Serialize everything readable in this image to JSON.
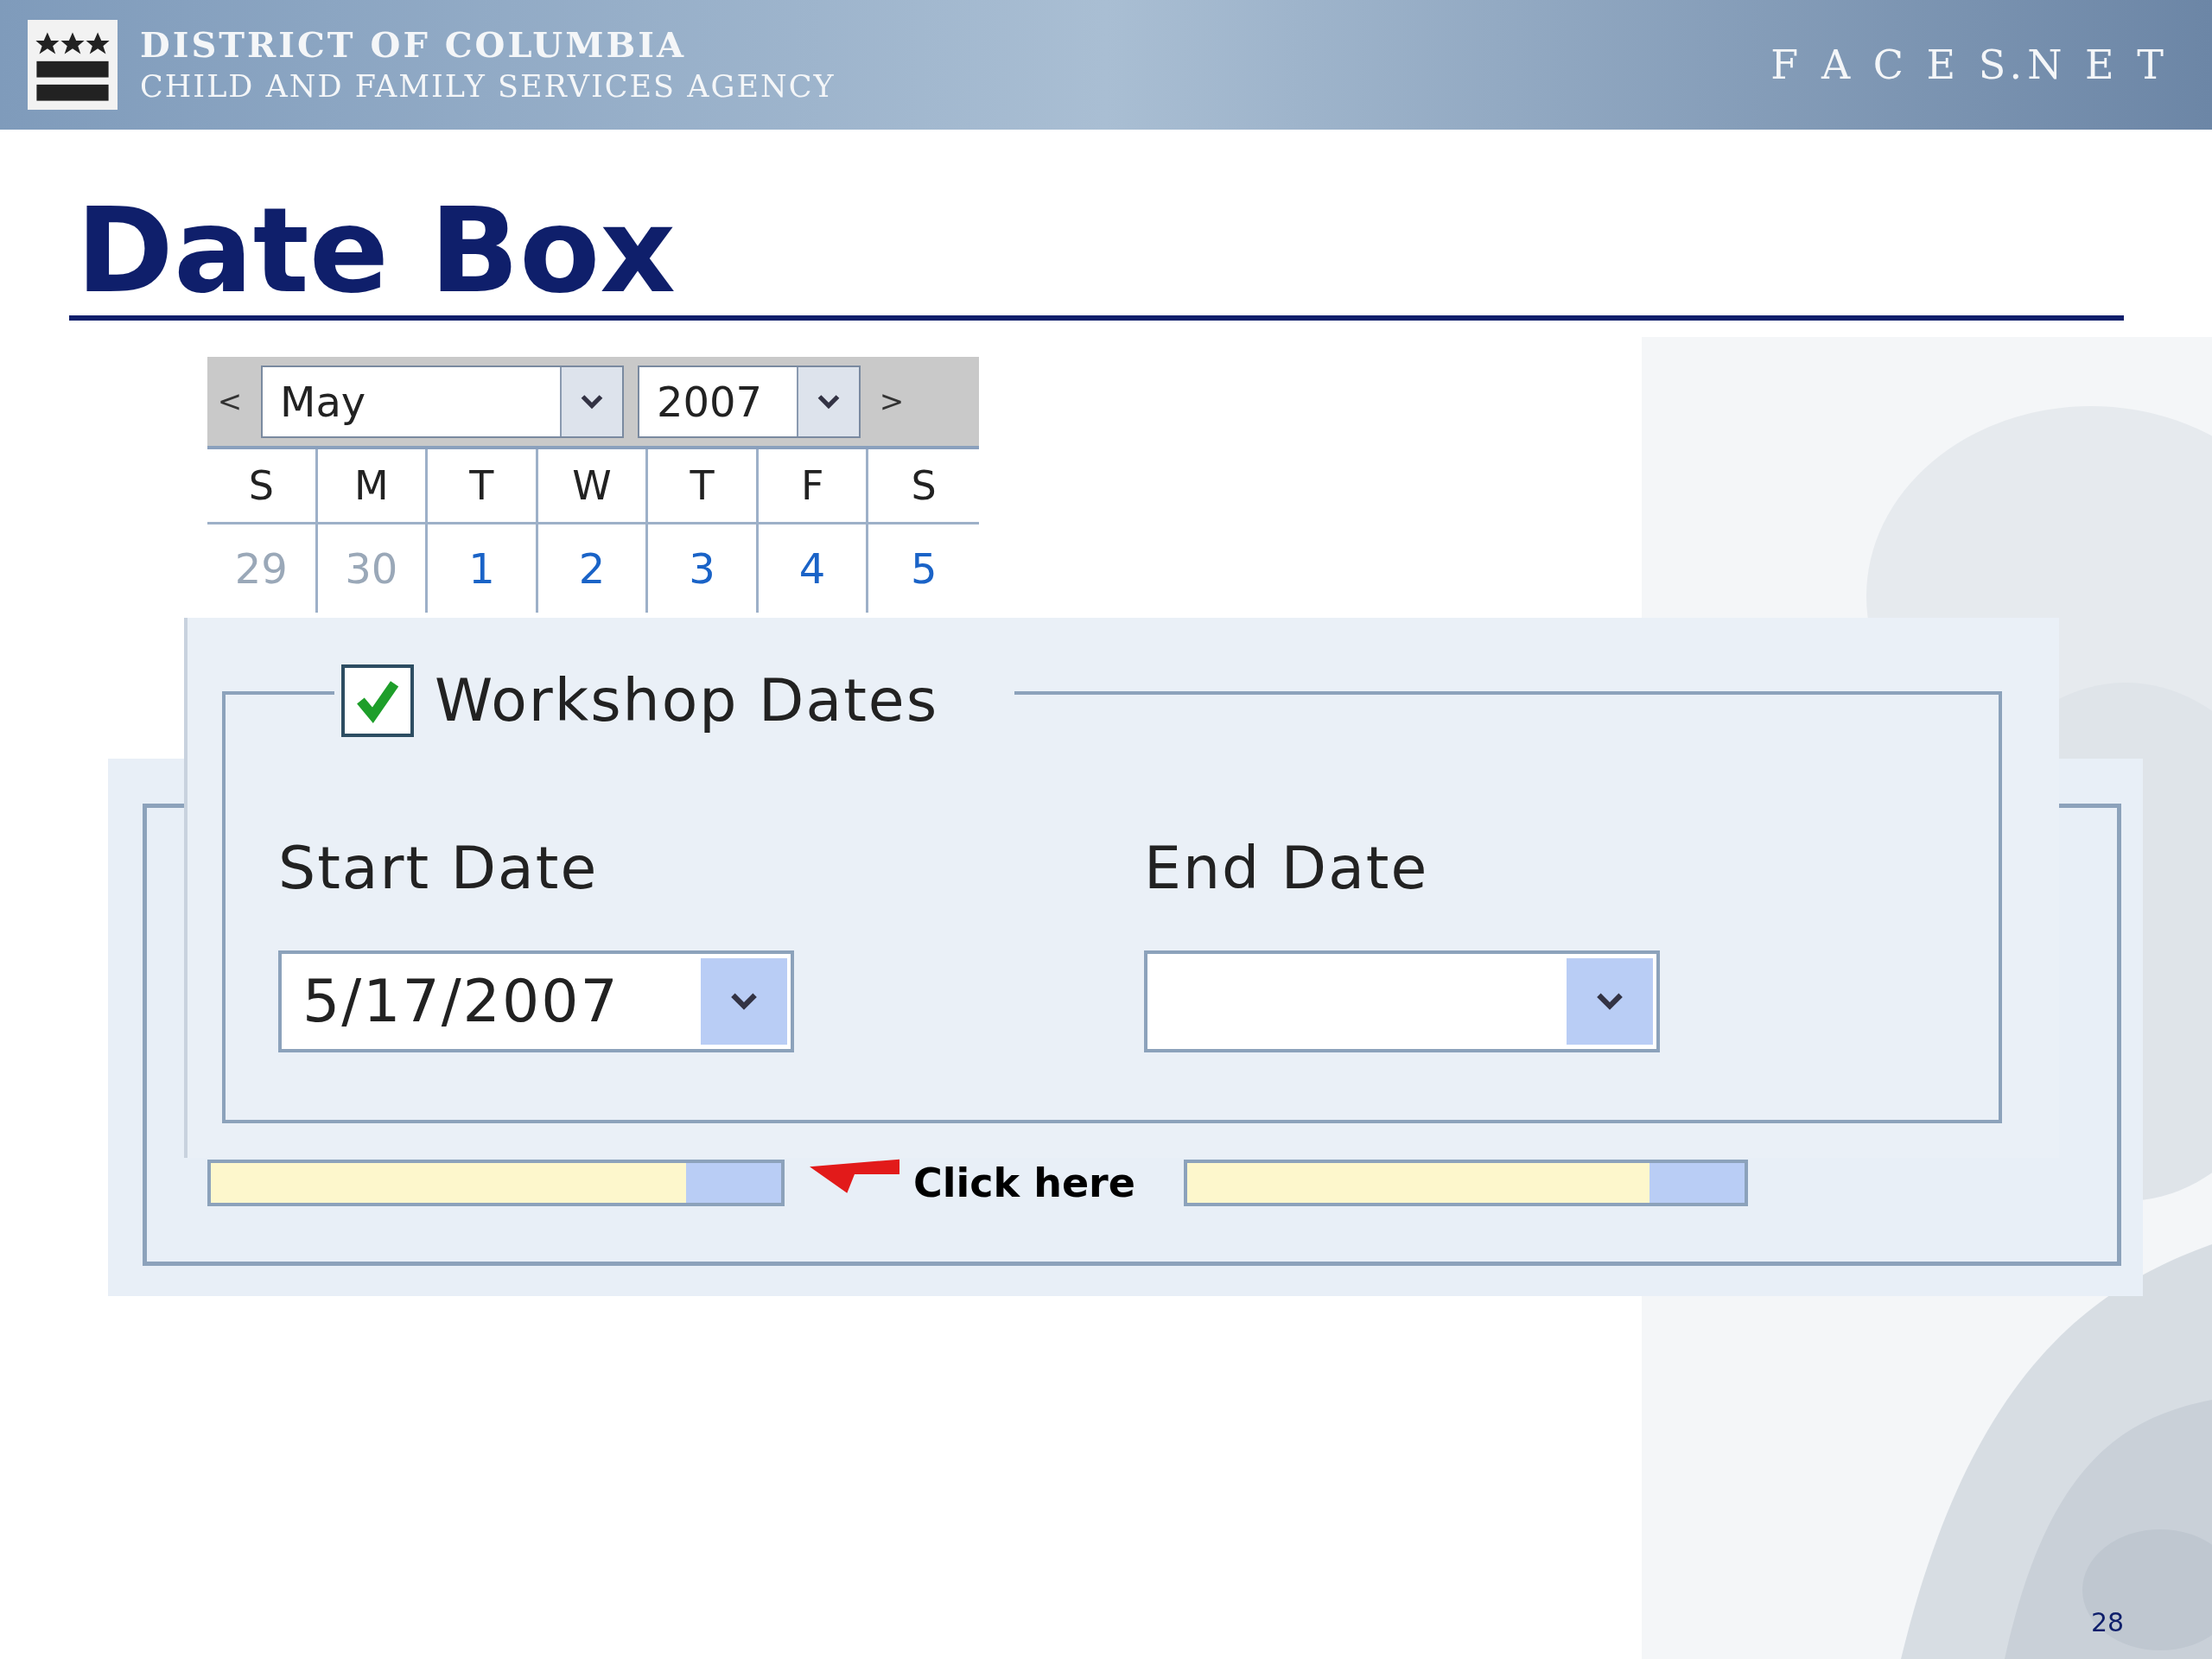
{
  "header": {
    "org": "DISTRICT OF COLUMBIA",
    "agency": "CHILD AND FAMILY SERVICES AGENCY",
    "product": "F A C E S.N E T"
  },
  "title": "Date Box",
  "calendar": {
    "prev": "<",
    "next": ">",
    "month": "May",
    "year": "2007",
    "weekdays": [
      "S",
      "M",
      "T",
      "W",
      "T",
      "F",
      "S"
    ],
    "days": [
      {
        "label": "29",
        "muted": true
      },
      {
        "label": "30",
        "muted": true
      },
      {
        "label": "1",
        "muted": false
      },
      {
        "label": "2",
        "muted": false
      },
      {
        "label": "3",
        "muted": false
      },
      {
        "label": "4",
        "muted": false
      },
      {
        "label": "5",
        "muted": false
      }
    ]
  },
  "workshop": {
    "legend": "Workshop Dates",
    "checked": true,
    "fields": [
      {
        "label": "Start Date",
        "value": "5/17/2007"
      },
      {
        "label": "End Date"
      }
    ]
  },
  "hint": "Click here",
  "page_number": "28"
}
